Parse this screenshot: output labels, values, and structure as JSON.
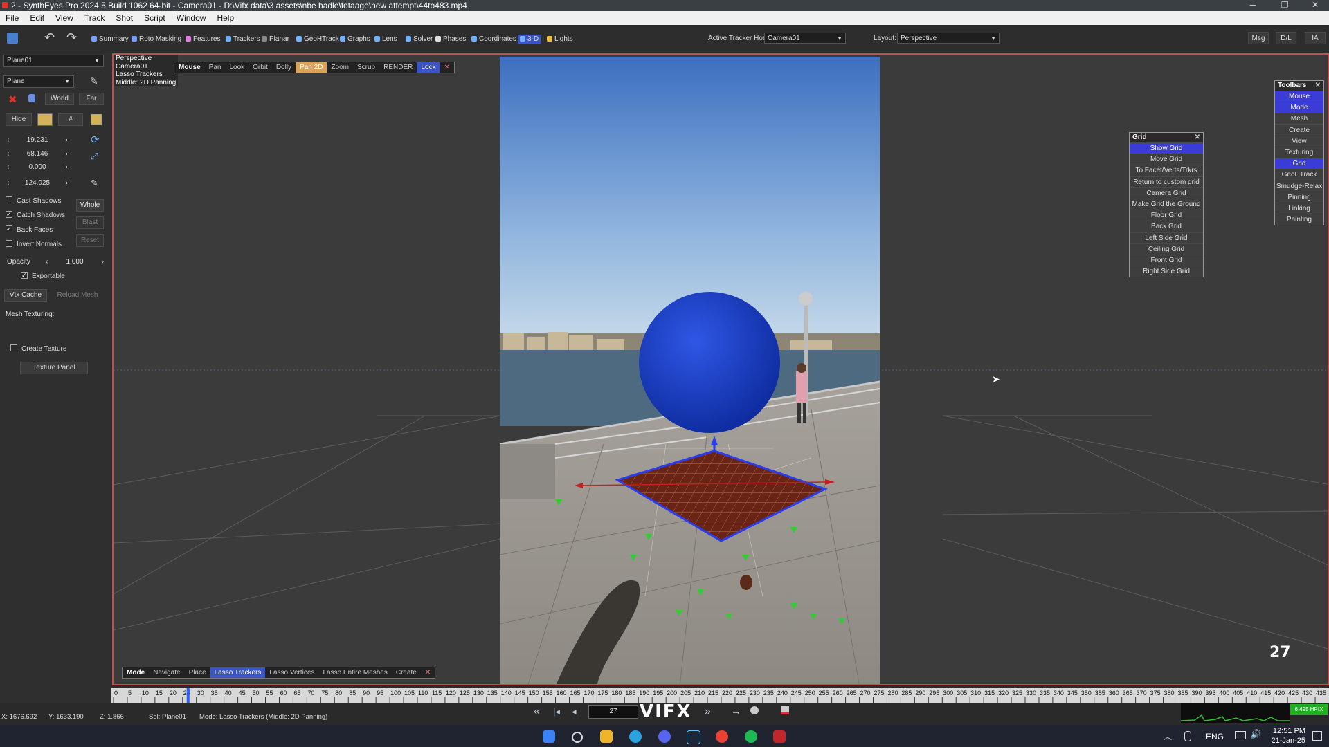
{
  "window": {
    "title": "2 - SynthEyes Pro 2024.5 Build 1062 64-bit - Camera01 - D:\\Vifx data\\3 assets\\nbe badle\\fotaage\\new attempt\\44to483.mp4",
    "controls": {
      "minimize": "─",
      "restore": "❐",
      "close": "✕"
    }
  },
  "menu": [
    "File",
    "Edit",
    "View",
    "Track",
    "Shot",
    "Script",
    "Window",
    "Help"
  ],
  "toolbar": {
    "room_buttons": [
      {
        "label": "Summary",
        "icon": "summary-icon",
        "color": "#7aa0ff"
      },
      {
        "label": "Roto Masking",
        "icon": "roto-icon",
        "color": "#7aa0ff"
      },
      {
        "label": "Features",
        "icon": "features-icon",
        "color": "#e080e0"
      },
      {
        "label": "Trackers",
        "icon": "trackers-icon",
        "color": "#6fb0ff"
      },
      {
        "label": "Planar",
        "icon": "planar-icon",
        "color": "#888888"
      },
      {
        "label": "GeoHTrack",
        "icon": "geohtrack-icon",
        "color": "#6fb0ff"
      },
      {
        "label": "Graphs",
        "icon": "graphs-icon",
        "color": "#6fb0ff"
      },
      {
        "label": "Lens",
        "icon": "lens-icon",
        "color": "#6fb0ff"
      },
      {
        "label": "Solver",
        "icon": "solver-icon",
        "color": "#6fb0ff"
      },
      {
        "label": "Phases",
        "icon": "phases-icon",
        "color": "#dddddd"
      },
      {
        "label": "Coordinates",
        "icon": "coordinates-icon",
        "color": "#6fb0ff"
      },
      {
        "label": "3-D",
        "icon": "3d-icon",
        "color": "#6fb0ff"
      },
      {
        "label": "Lights",
        "icon": "lights-icon",
        "color": "#f0c040"
      }
    ],
    "active_tracker_host_label": "Active Tracker Host:",
    "active_tracker_host_value": "Camera01",
    "layout_label": "Layout:",
    "layout_value": "Perspective",
    "right_buttons": [
      "Msg",
      "D/L",
      "IA"
    ]
  },
  "left_panel": {
    "object_select": "Plane01",
    "type_select": "Plane",
    "world_button": "World",
    "far_button": "Far",
    "hide_button": "Hide",
    "hash_button": "#",
    "values": [
      "19.231",
      "68.146",
      "0.000",
      "124.025"
    ],
    "cast_shadows": {
      "label": "Cast Shadows",
      "checked": false
    },
    "whole_button": "Whole",
    "catch_shadows": {
      "label": "Catch Shadows",
      "checked": true
    },
    "blast_button": "Blast",
    "back_faces": {
      "label": "Back Faces",
      "checked": true
    },
    "invert_normals": {
      "label": "Invert Normals",
      "checked": false
    },
    "reset_button": "Reset",
    "opacity_label": "Opacity",
    "opacity_value": "1.000",
    "exportable": {
      "label": "Exportable",
      "checked": true
    },
    "vtx_cache_button": "Vtx Cache",
    "reload_mesh_button": "Reload Mesh",
    "mesh_texturing_label": "Mesh Texturing:",
    "create_texture": {
      "label": "Create Texture",
      "checked": false
    },
    "texture_panel_button": "Texture Panel",
    "color_swatch": "#d4b25a"
  },
  "viewport": {
    "info_lines": [
      "Perspective",
      "Camera01",
      "Lasso Trackers",
      "Middle: 2D Panning"
    ],
    "mouse_bar": [
      "Mouse",
      "Pan",
      "Look",
      "Orbit",
      "Dolly",
      "Pan 2D",
      "Zoom",
      "Scrub",
      "RENDER",
      "Lock",
      "✕"
    ],
    "mouse_bar_active": "Pan 2D",
    "mode_bar": [
      "Mode",
      "Navigate",
      "Place",
      "Lasso Trackers",
      "Lasso Vertices",
      "Lasso Entire Meshes",
      "Create",
      "✕"
    ],
    "mode_bar_active": "Lasso Trackers",
    "frame_counter": "27",
    "sphere_color": "#1d3fd0",
    "plane_color": "#6a2416"
  },
  "grid_popup": {
    "title": "Grid",
    "close": "✕",
    "items": [
      "Show Grid",
      "Move Grid",
      "To Facet/Verts/Trkrs",
      "Return to custom grid",
      "Camera Grid",
      "Make Grid the Ground",
      "Floor Grid",
      "Back Grid",
      "Left Side Grid",
      "Ceiling Grid",
      "Front Grid",
      "Right Side Grid"
    ],
    "active": "Show Grid"
  },
  "toolbars_popup": {
    "title": "Toolbars",
    "close": "✕",
    "items": [
      "Mouse",
      "Mode",
      "Mesh",
      "Create",
      "View",
      "Texturing",
      "Grid",
      "GeoHTrack",
      "Smudge-Relax",
      "Pinning",
      "Linking",
      "Painting"
    ],
    "active": [
      "Mouse",
      "Mode",
      "Grid"
    ]
  },
  "timeline": {
    "ticks": [
      "0",
      "5",
      "10",
      "15",
      "20",
      "25",
      "30",
      "35",
      "40",
      "45",
      "50",
      "55",
      "60",
      "65",
      "70",
      "75",
      "80",
      "85",
      "90",
      "95",
      "100",
      "105",
      "110",
      "115",
      "120",
      "125",
      "130",
      "135",
      "140",
      "145",
      "150",
      "155",
      "160",
      "165",
      "170",
      "175",
      "180",
      "185",
      "190",
      "195",
      "200",
      "205",
      "210",
      "215",
      "220",
      "225",
      "230",
      "235",
      "240",
      "245",
      "250",
      "255",
      "260",
      "265",
      "270",
      "275",
      "280",
      "285",
      "290",
      "295",
      "300",
      "305",
      "310",
      "315",
      "320",
      "325",
      "330",
      "335",
      "340",
      "345",
      "350",
      "355",
      "360",
      "365",
      "370",
      "375",
      "380",
      "385",
      "390",
      "395",
      "400",
      "405",
      "410",
      "415",
      "420",
      "425",
      "430",
      "435"
    ],
    "current_frame": 27,
    "max_frame": 439
  },
  "status": {
    "x": "X: 1676.692",
    "y": "Y: 1633.190",
    "z": "Z: 1.866",
    "sel": "Sel: Plane01",
    "mode": "Mode: Lasso Trackers (Middle: 2D Panning)",
    "frame_field": "27",
    "logo": "VIFX",
    "perf": "6.495 HPIX"
  },
  "taskbar": {
    "lang": "ENG",
    "time": "12:51 PM",
    "date": "21-Jan-25"
  }
}
